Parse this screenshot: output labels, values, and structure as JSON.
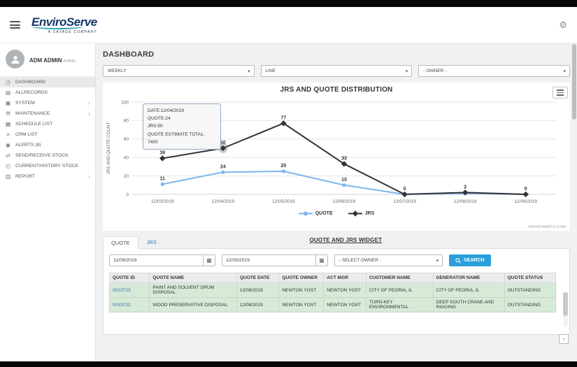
{
  "header": {
    "brand": "EnviroServe",
    "brand_sub": "A SAVAGE COMPANY"
  },
  "sidebar": {
    "user": {
      "name": "ADM ADMIN",
      "role": "ADMIN"
    },
    "items": [
      {
        "label": "DASHBOARD",
        "icon": "dashboard-icon",
        "glyph": "◷",
        "active": true,
        "has_children": false
      },
      {
        "label": "ALLRECORDS",
        "icon": "records-icon",
        "glyph": "▤",
        "active": false,
        "has_children": false
      },
      {
        "label": "SYSTEM",
        "icon": "system-icon",
        "glyph": "▣",
        "active": false,
        "has_children": true
      },
      {
        "label": "MAINTENANCE",
        "icon": "maintenance-wrench-icon",
        "glyph": "⚒",
        "active": false,
        "has_children": true
      },
      {
        "label": "SCHEDULE LIST",
        "icon": "calendar-icon",
        "glyph": "▦",
        "active": false,
        "has_children": false
      },
      {
        "label": "CRM LIST",
        "icon": "list-icon",
        "glyph": "≡",
        "active": false,
        "has_children": false
      },
      {
        "label": "ALERTS (8)",
        "icon": "bell-icon",
        "glyph": "◉",
        "active": false,
        "has_children": false
      },
      {
        "label": "SEND/RECEIVE STOCK",
        "icon": "send-receive-icon",
        "glyph": "⇄",
        "active": false,
        "has_children": false
      },
      {
        "label": "CURRENT/HISTORY STOCK",
        "icon": "history-clock-icon",
        "glyph": "◴",
        "active": false,
        "has_children": false
      },
      {
        "label": "REPORT",
        "icon": "report-icon",
        "glyph": "▥",
        "active": false,
        "has_children": true
      }
    ]
  },
  "main": {
    "title": "DASHBOARD",
    "filters": {
      "period": "WEEKLY",
      "chart_type": "LINE",
      "owner": "- OWNER -"
    }
  },
  "chart_data": {
    "type": "line",
    "title": "JRS AND QUOTE DISTRIBUTION",
    "ylabel": "JRS AND QUOTE COUNT",
    "xlabel": "",
    "ylim": [
      0,
      100
    ],
    "yticks": [
      0,
      20,
      40,
      60,
      80,
      100
    ],
    "grid": true,
    "legend_position": "bottom",
    "categories": [
      "12/03/2019",
      "12/04/2019",
      "12/05/2019",
      "12/06/2019",
      "12/07/2019",
      "12/08/2019",
      "12/09/2019"
    ],
    "series": [
      {
        "name": "QUOTE",
        "color": "#7cb5ec",
        "marker": "circle",
        "values": [
          11,
          24,
          25,
          10,
          0,
          1,
          0
        ],
        "labels": [
          "11",
          "24",
          "25",
          "10",
          "",
          "",
          ""
        ]
      },
      {
        "name": "JRS",
        "color": "#333338",
        "marker": "diamond",
        "values": [
          39,
          50,
          77,
          33,
          0,
          2,
          0
        ],
        "labels": [
          "39",
          "50",
          "77",
          "33",
          "0",
          "2",
          "0"
        ]
      }
    ],
    "hover": {
      "series": "JRS",
      "index": 1
    },
    "tooltip": [
      "DATE:12/04/2019",
      "QUOTE:24",
      "JRS:50",
      "QUOTE ESTIMATE TOTAL: 7400"
    ],
    "credit": "HIGHCHARTS.COM"
  },
  "widget": {
    "tabs": [
      {
        "label": "QUOTE",
        "active": true
      },
      {
        "label": "JRS",
        "active": false
      }
    ],
    "title": "QUOTE AND JRS WIDGET",
    "date_from": "11/09/2019",
    "date_to": "12/09/2019",
    "owner_placeholder": "- SELECT OWNER -",
    "search_label": "SEARCH",
    "table": {
      "headers": [
        "QUOTE ID",
        "QUOTE NAME",
        "QUOTE DATE",
        "QUOTE OWNER",
        "ACT MGR",
        "CUSTOMER NAME",
        "GENERATOR NAME",
        "QUOTE STATUS"
      ],
      "rows": [
        [
          "0013723",
          "PAINT AND SOLVENT DRUM DISPOSAL",
          "12/08/2019",
          "NEWTON YOST",
          "NEWTON YOST",
          "CITY OF PEORIA, IL",
          "CITY OF PEORIA, IL",
          "OUTSTANDING"
        ],
        [
          "0013722",
          "WOOD PRESERVATIVE DISPOSAL",
          "12/08/2019",
          "NEWTON YOST",
          "NEWTON YOST",
          "TURN-KEY ENVIRONMENTAL",
          "DEEP SOUTH CRANE AND RIGGING",
          "OUTSTANDING"
        ]
      ],
      "row_highlight_color": "#d7ead7",
      "link_color": "#2a6db5"
    }
  }
}
